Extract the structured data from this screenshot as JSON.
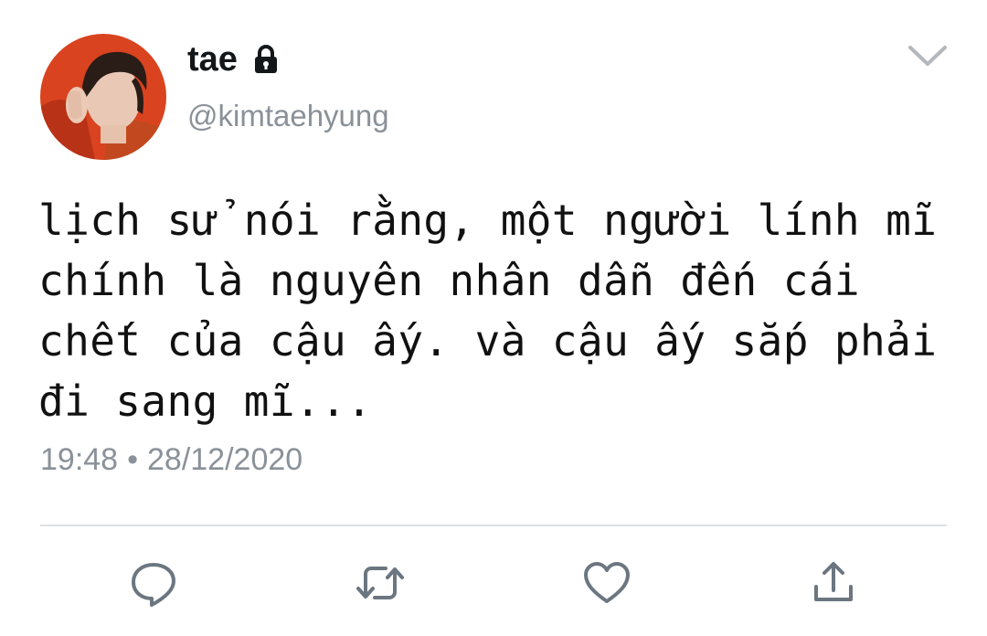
{
  "tweet": {
    "display_name": "tae",
    "handle": "@kimtaehyung",
    "text_lines": [
      "lịch sử nói rằng, một người lính mĩ",
      "chính là nguyên nhân dẫn đến cái",
      "chết của cậu ấy. và cậu ấy sắp phải",
      "đi sang mĩ..."
    ],
    "time": "19:48",
    "separator": "•",
    "date": "28/12/2020"
  },
  "icons": {
    "protected": "lock-icon",
    "menu": "chevron-down-icon",
    "reply": "reply-icon",
    "retweet": "retweet-icon",
    "like": "heart-icon",
    "share": "share-icon"
  },
  "colors": {
    "text": "#14171a",
    "secondary": "#8a9199",
    "icon": "#6b7680",
    "divider": "#dde1e4",
    "background": "#ffffff"
  }
}
